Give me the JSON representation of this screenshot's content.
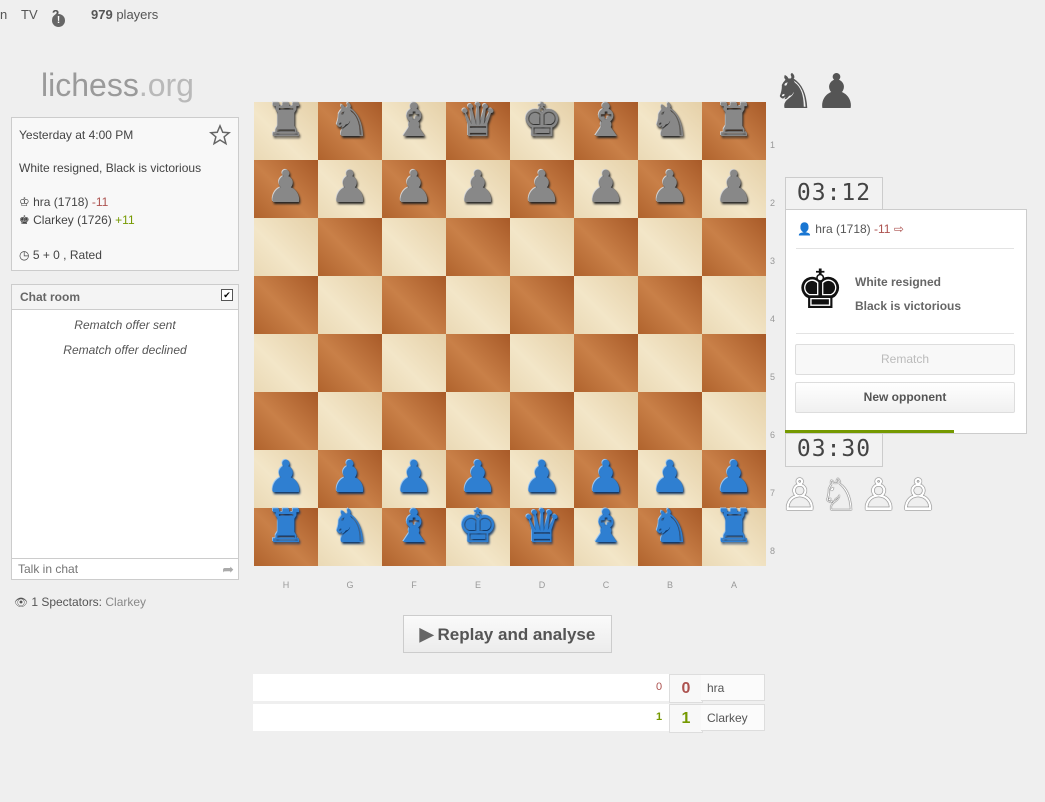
{
  "topbar": {
    "left_partial": "n",
    "tv": "TV",
    "notifications_icon": "!",
    "notifications_count": "2",
    "players_count": "979",
    "players_label": "players"
  },
  "logo": {
    "name": "lichess",
    "tld": ".org"
  },
  "game_info": {
    "date": "Yesterday at 4:00 PM",
    "status": "White resigned, Black is victorious",
    "white_player": "hra (1718)",
    "white_diff": "-11",
    "black_player": "Clarkey (1726)",
    "black_diff": "+11",
    "time_control": "5 + 0 , Rated",
    "icons": {
      "bookmark": "star-icon",
      "white": "white-king-icon",
      "black": "black-king-icon",
      "clock": "clock-icon"
    }
  },
  "chat": {
    "title": "Chat room",
    "messages": [
      "Rematch offer sent",
      "Rematch offer declined"
    ],
    "input_placeholder": "Talk in chat"
  },
  "spectators": {
    "label": "1 Spectators:",
    "names": "Clarkey"
  },
  "board": {
    "ranks": [
      "1",
      "2",
      "3",
      "4",
      "5",
      "6",
      "7",
      "8"
    ],
    "files": [
      "H",
      "G",
      "F",
      "E",
      "D",
      "C",
      "B",
      "A"
    ],
    "orientation": "black",
    "rows": [
      [
        "r",
        "n",
        "b",
        "q",
        "k",
        "b",
        "n",
        "r"
      ],
      [
        "p",
        "p",
        "p",
        "p",
        "p",
        "p",
        "p",
        "p"
      ],
      [
        "",
        "",
        "",
        "",
        "",
        "",
        "",
        ""
      ],
      [
        "",
        "",
        "",
        "",
        "",
        "",
        "",
        ""
      ],
      [
        "",
        "",
        "",
        "",
        "",
        "",
        "",
        ""
      ],
      [
        "",
        "",
        "",
        "",
        "",
        "",
        "",
        ""
      ],
      [
        "P",
        "P",
        "P",
        "P",
        "P",
        "P",
        "P",
        "P"
      ],
      [
        "R",
        "N",
        "B",
        "K",
        "Q",
        "B",
        "N",
        "R"
      ]
    ],
    "piece_colors": {
      "black": "#888888",
      "white": "#2f7fd1"
    },
    "glyphs": {
      "r": "♜",
      "n": "♞",
      "b": "♝",
      "q": "♛",
      "k": "♚",
      "p": "♟",
      "R": "♜",
      "N": "♞",
      "B": "♝",
      "Q": "♛",
      "K": "♚",
      "P": "♟"
    }
  },
  "right_panel": {
    "captured_top": "♞♟",
    "captured_bottom": "♙♘♙♙",
    "clock_top": "03:12",
    "clock_bottom": "03:30",
    "player_line_name": "hra (1718)",
    "player_line_diff": "-11",
    "result_icon": "♚",
    "result_line1": "White resigned",
    "result_line2": "Black is victorious",
    "rematch_label": "Rematch",
    "new_opponent_label": "New opponent",
    "accent_color": "#759900"
  },
  "replay": {
    "label": "Replay and analyse",
    "icon": "play-icon"
  },
  "crosstable": {
    "rows": [
      {
        "score": "0",
        "total": "0",
        "name": "hra",
        "color": "#ac524f"
      },
      {
        "score": "1",
        "total": "1",
        "name": "Clarkey",
        "color": "#759900"
      }
    ]
  }
}
